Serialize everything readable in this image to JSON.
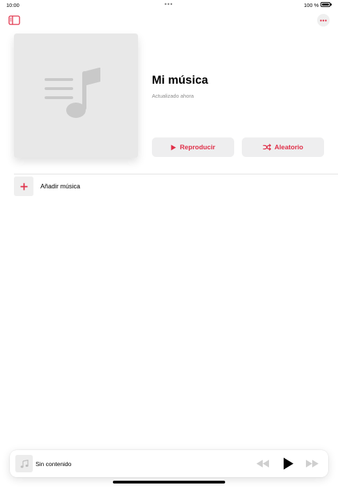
{
  "status_bar": {
    "time": "10:00",
    "battery_percent": "100 %",
    "dots": "•••"
  },
  "header": {
    "sidebar_icon": "sidebar-toggle-icon",
    "more_icon": "ellipsis-icon"
  },
  "playlist": {
    "title": "Mi música",
    "subtitle": "Actualizado ahora",
    "artwork_icon": "music-list-icon"
  },
  "actions": {
    "play_label": "Reproducir",
    "shuffle_label": "Aleatorio"
  },
  "list": {
    "add_label": "Añadir música"
  },
  "mini_player": {
    "title": "Sin contenido",
    "artwork_icon": "music-note-icon"
  },
  "colors": {
    "accent": "#e03049",
    "artwork_bg": "#e8e8e8",
    "artwork_glyph": "#c9c9c9",
    "button_bg": "#eeeeef"
  }
}
